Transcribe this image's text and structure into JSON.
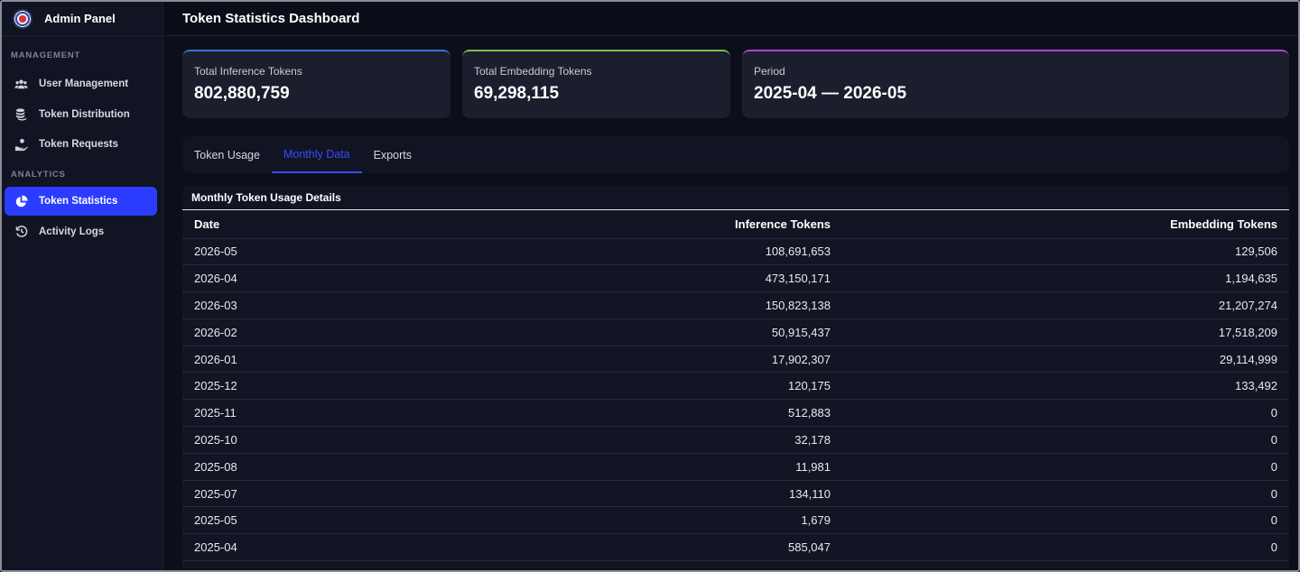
{
  "sidebar": {
    "brand": "Admin Panel",
    "sections": [
      {
        "label": "MANAGEMENT",
        "items": [
          {
            "label": "User Management",
            "icon": "users-icon"
          },
          {
            "label": "Token Distribution",
            "icon": "coins-icon"
          },
          {
            "label": "Token Requests",
            "icon": "hand-coin-icon"
          }
        ]
      },
      {
        "label": "ANALYTICS",
        "items": [
          {
            "label": "Token Statistics",
            "icon": "pie-chart-icon",
            "active": true
          },
          {
            "label": "Activity Logs",
            "icon": "history-icon"
          }
        ]
      }
    ]
  },
  "header": {
    "title": "Token Statistics Dashboard"
  },
  "cards": [
    {
      "label": "Total Inference Tokens",
      "value": "802,880,759",
      "accent": "#3b6fd8"
    },
    {
      "label": "Total Embedding Tokens",
      "value": "69,298,115",
      "accent": "#7bc24a"
    },
    {
      "label": "Period",
      "value": "2025-04 — 2026-05",
      "accent": "#b53fd4"
    }
  ],
  "tabs": [
    {
      "label": "Token Usage"
    },
    {
      "label": "Monthly Data",
      "active": true
    },
    {
      "label": "Exports"
    }
  ],
  "table": {
    "title": "Monthly Token Usage Details",
    "columns": [
      "Date",
      "Inference Tokens",
      "Embedding Tokens"
    ],
    "rows": [
      [
        "2026-05",
        "108,691,653",
        "129,506"
      ],
      [
        "2026-04",
        "473,150,171",
        "1,194,635"
      ],
      [
        "2026-03",
        "150,823,138",
        "21,207,274"
      ],
      [
        "2026-02",
        "50,915,437",
        "17,518,209"
      ],
      [
        "2026-01",
        "17,902,307",
        "29,114,999"
      ],
      [
        "2025-12",
        "120,175",
        "133,492"
      ],
      [
        "2025-11",
        "512,883",
        "0"
      ],
      [
        "2025-10",
        "32,178",
        "0"
      ],
      [
        "2025-08",
        "11,981",
        "0"
      ],
      [
        "2025-07",
        "134,110",
        "0"
      ],
      [
        "2025-05",
        "1,679",
        "0"
      ],
      [
        "2025-04",
        "585,047",
        "0"
      ]
    ]
  },
  "colors": {
    "accent": "#2b3cff",
    "background": "#0c0e1a",
    "panel": "#111423"
  }
}
